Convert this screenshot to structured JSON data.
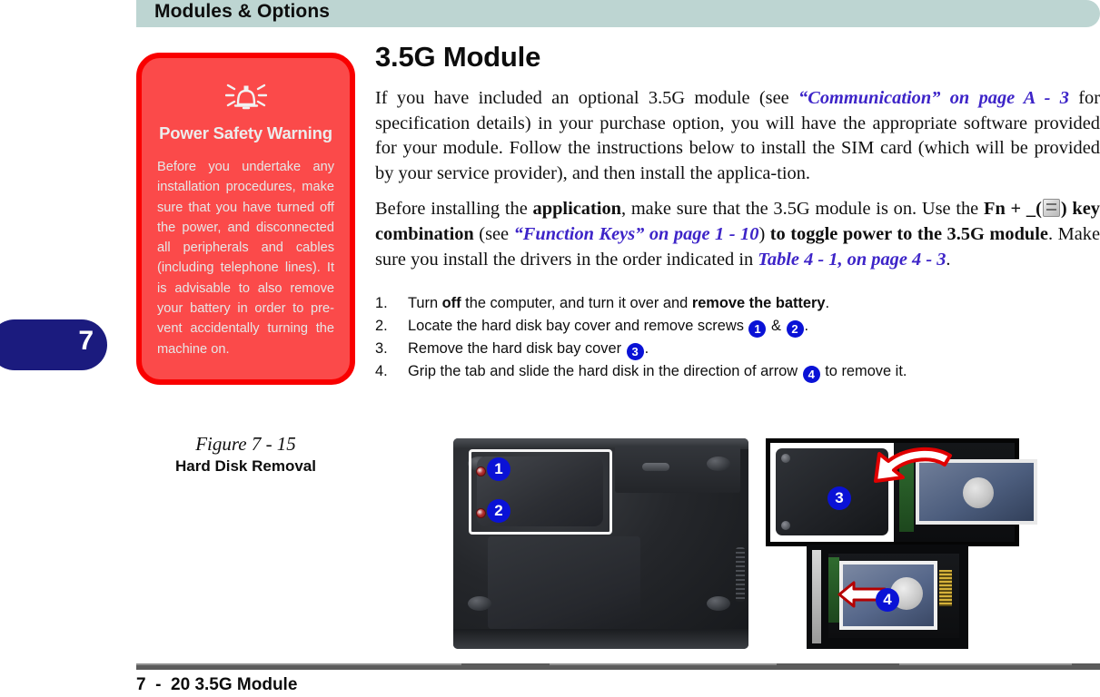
{
  "header": {
    "title": "Modules & Options"
  },
  "chapter_tab": {
    "number": "7",
    "color": "#1b1b7e"
  },
  "sidebar": {
    "warning": {
      "icon": "alarm-bell-icon",
      "title": "Power Safety Warning",
      "body": "Before you undertake any installation proce­dures, make sure that you have turned off the power, and disconnect­ed all peripherals and cables (including tele­phone lines). It is advis­able to also remove your battery in order to pre­vent accidentally turning the machine on.",
      "border_color": "#f90000",
      "fill_color": "#fb4a4a"
    },
    "figure": {
      "number": "Figure 7 - 15",
      "title": "Hard Disk Removal"
    }
  },
  "main": {
    "title": "3.5G Module",
    "paragraph1": {
      "part1": "If you have included an optional 3.5G module (see ",
      "xref1": "“Communication” on page  A - 3",
      "part2": " for specification details) in your purchase option, you will have the appropriate software provided for your module. Follow the instructions below to install the SIM card (which will be provided by your service provider), and then install the applica-tion."
    },
    "paragraph2": {
      "part1": "Before installing the ",
      "bold1": "application",
      "part2": ", make sure that the 3.5G module is on. Use the ",
      "bold2": "Fn + _(",
      "key_icon": "function-key-icon",
      "bold3": ") key combination",
      "part3": " (see ",
      "xref1": "“Function Keys” on page 1 - 10",
      "part4": ") ",
      "bold4": "to toggle power to the 3.5G module",
      "part5": ". Make sure you install the drivers in the order indicated in ",
      "xref2": "Table 4 - 1, on page 4 - 3",
      "part6": "."
    },
    "xref_color": "#3d24c8",
    "steps": [
      {
        "num": "1.",
        "pre": "Turn ",
        "bold1": "off",
        "mid": " the computer, and turn it over and ",
        "bold2": "remove the battery",
        "post": "."
      },
      {
        "num": "2.",
        "pre": "Locate the hard disk bay cover and remove screws ",
        "badge1": "1",
        "mid": " & ",
        "badge2": "2",
        "post": "."
      },
      {
        "num": "3.",
        "pre": "Remove the hard disk bay cover ",
        "badge1": "3",
        "post": "."
      },
      {
        "num": "4.",
        "pre": "Grip the tab and slide the hard disk in the direction of arrow ",
        "badge1": "4",
        "post": " to remove it."
      }
    ],
    "callout_color": "#0a12d6"
  },
  "figure_callouts": {
    "laptop_1": "1",
    "laptop_2": "2",
    "cover_3": "3",
    "slide_4": "4"
  },
  "footer": {
    "page": "7  -  20",
    "section": "3.5G Module"
  }
}
